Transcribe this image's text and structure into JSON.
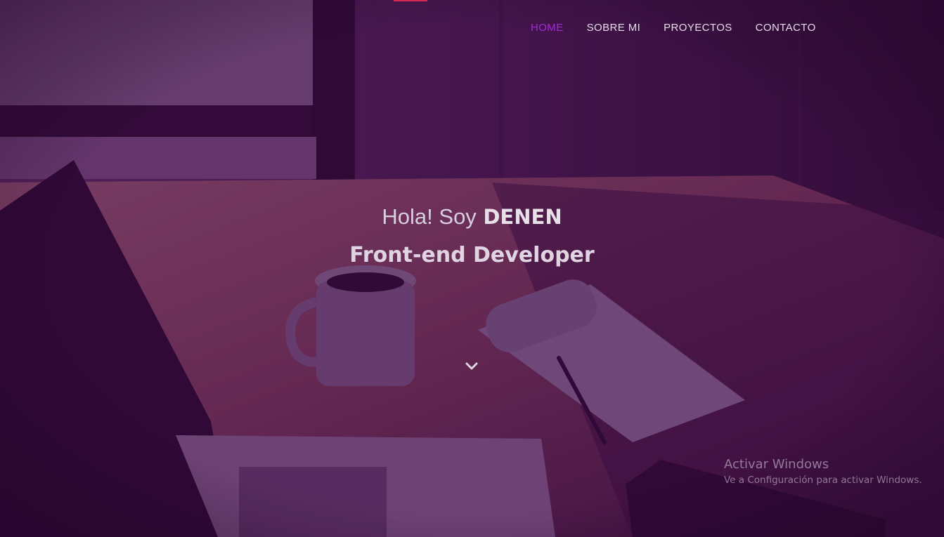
{
  "nav": {
    "items": [
      {
        "label": "HOME",
        "active": true
      },
      {
        "label": "SOBRE MI",
        "active": false
      },
      {
        "label": "PROYECTOS",
        "active": false
      },
      {
        "label": "CONTACTO",
        "active": false
      }
    ]
  },
  "hero": {
    "greeting": "Hola! Soy",
    "name": "DENEN",
    "role": "Front-end Developer",
    "scroll_icon": "chevron-down-icon"
  },
  "watermark": {
    "title": "Activar Windows",
    "subtitle": "Ve a Configuración para activar Windows."
  },
  "colors": {
    "accent": "#a12bd6",
    "top_accent": "#d32b4f",
    "overlay": "#3c0a46",
    "nav_text": "#e6dbe9"
  }
}
